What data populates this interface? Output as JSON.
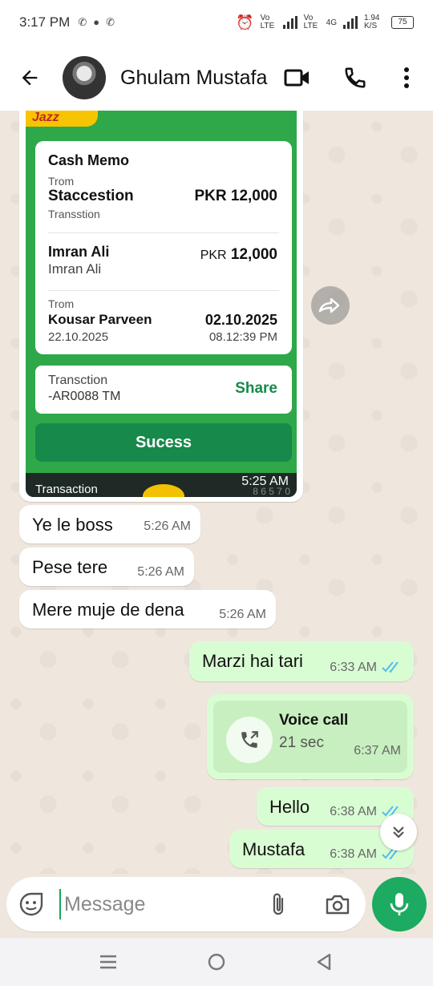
{
  "status_bar": {
    "time": "3:17 PM",
    "network_labels": [
      "Vo LTE",
      "Vo LTE",
      "4G"
    ],
    "speed": "1.94 K/S",
    "battery": "75",
    "icons": [
      "missed-call-icon",
      "chat-bubble-icon",
      "missed-call-icon",
      "alarm-icon",
      "signal-icon",
      "signal-icon",
      "battery-icon"
    ]
  },
  "header": {
    "contact_name": "Ghulam Mustafa",
    "icons": [
      "back-arrow-icon",
      "video-call-icon",
      "phone-icon",
      "more-vert-icon"
    ]
  },
  "receipt": {
    "brand": "Jazz",
    "title": "Cash Memo",
    "from_label": "Trom",
    "from_name": "Staccestion",
    "from_amount": "PKR 12,000",
    "from_sub": "Transstion",
    "to_name": "Imran Ali",
    "to_sub": "Imran Ali",
    "to_currency": "PKR",
    "to_amount": "12,000",
    "sender_label": "Trom",
    "sender_name": "Kousar Parveen",
    "sender_date_left": "22.10.2025",
    "date": "02.10.2025",
    "time": "08.12:39 PM",
    "txn_label": "Transction",
    "txn_id": "-AR0088 TM",
    "share": "Share",
    "success": "Sucess",
    "bottom_label": "Transaction",
    "bottom_num": "8 6 5 7 0",
    "timestamp": "5:25 AM"
  },
  "messages": [
    {
      "direction": "in",
      "text": "Ye le boss",
      "time": "5:26 AM"
    },
    {
      "direction": "in",
      "text": "Pese tere",
      "time": "5:26 AM"
    },
    {
      "direction": "in",
      "text": "Mere muje de dena",
      "time": "5:26 AM"
    },
    {
      "direction": "out",
      "text": "Marzi hai tari",
      "time": "6:33 AM",
      "status": "read"
    },
    {
      "direction": "out",
      "type": "voice-call",
      "title": "Voice call",
      "duration": "21 sec",
      "time": "6:37 AM"
    },
    {
      "direction": "out",
      "text": "Hello",
      "time": "6:38 AM",
      "status": "read"
    },
    {
      "direction": "out",
      "text": "Mustafa",
      "time": "6:38 AM",
      "status": "read"
    }
  ],
  "composer": {
    "placeholder": "Message",
    "value": "",
    "icons": [
      "sticker-icon",
      "attach-icon",
      "camera-icon",
      "mic-icon"
    ]
  },
  "colors": {
    "chat_bg": "#efe7de",
    "incoming": "#ffffff",
    "outgoing": "#d9fdd3",
    "accent": "#1daa61",
    "read_ticks": "#53bdeb",
    "receipt_green": "#2fa84a"
  },
  "nav": {
    "icons": [
      "recents-icon",
      "home-icon",
      "back-nav-icon"
    ]
  }
}
